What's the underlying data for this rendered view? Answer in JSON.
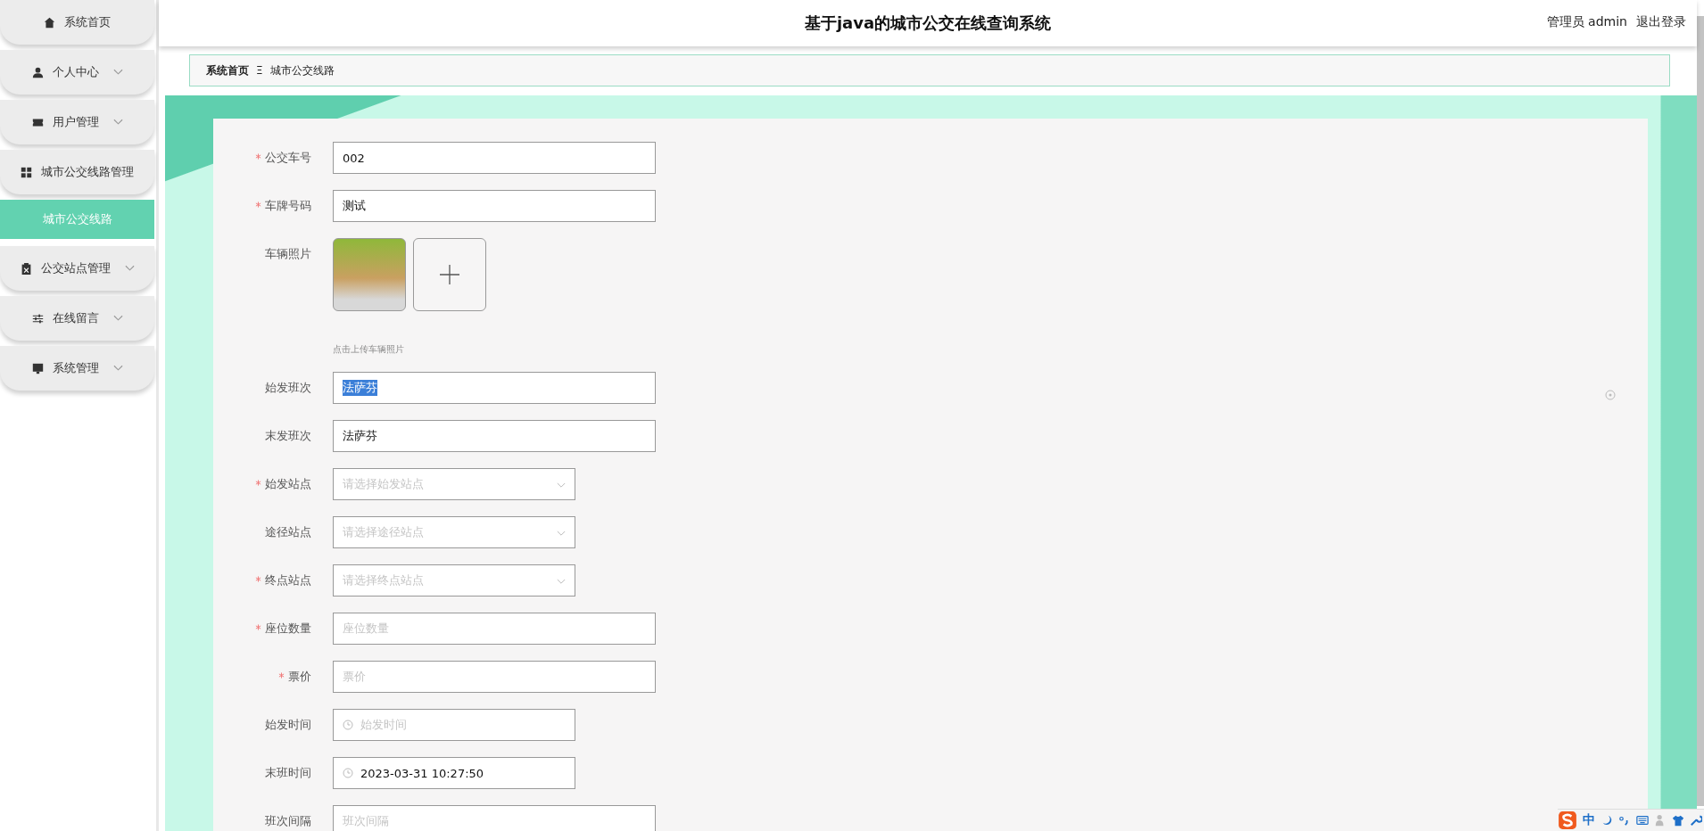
{
  "header": {
    "title": "基于java的城市公交在线查询系统",
    "user": "管理员 admin",
    "logout": "退出登录"
  },
  "sidebar": {
    "items": [
      {
        "label": "系统首页",
        "expandable": false,
        "selected": false
      },
      {
        "label": "个人中心",
        "expandable": true,
        "selected": false
      },
      {
        "label": "用户管理",
        "expandable": true,
        "selected": false
      },
      {
        "label": "城市公交线路管理",
        "expandable": false,
        "selected": false
      },
      {
        "label": "城市公交线路",
        "expandable": false,
        "selected": true
      },
      {
        "label": "公交站点管理",
        "expandable": true,
        "selected": false
      },
      {
        "label": "在线留言",
        "expandable": true,
        "selected": false
      },
      {
        "label": "系统管理",
        "expandable": true,
        "selected": false
      }
    ]
  },
  "breadcrumb": {
    "home": "系统首页",
    "separator": "Ξ",
    "current": "城市公交线路"
  },
  "form": {
    "fields": [
      {
        "kind": "text",
        "label": "公交车号",
        "required": true,
        "value": "002"
      },
      {
        "kind": "text",
        "label": "车牌号码",
        "required": true,
        "value": "测试"
      },
      {
        "kind": "upload",
        "label": "车辆照片",
        "required": false,
        "hint": "点击上传车辆照片"
      },
      {
        "kind": "text",
        "label": "始发班次",
        "required": false,
        "value": "法萨芬",
        "highlighted": true
      },
      {
        "kind": "text",
        "label": "末发班次",
        "required": false,
        "value": "法萨芬"
      },
      {
        "kind": "select",
        "label": "始发站点",
        "required": true,
        "placeholder": "请选择始发站点"
      },
      {
        "kind": "select",
        "label": "途径站点",
        "required": false,
        "placeholder": "请选择途径站点"
      },
      {
        "kind": "select",
        "label": "终点站点",
        "required": true,
        "placeholder": "请选择终点站点"
      },
      {
        "kind": "text",
        "label": "座位数量",
        "required": true,
        "placeholder": "座位数量"
      },
      {
        "kind": "text",
        "label": "票价",
        "required": true,
        "placeholder": "票价"
      },
      {
        "kind": "date",
        "label": "始发时间",
        "required": false,
        "placeholder": "始发时间"
      },
      {
        "kind": "date",
        "label": "末班时间",
        "required": false,
        "value": "2023-03-31 10:27:50"
      },
      {
        "kind": "text",
        "label": "班次间隔",
        "required": false,
        "placeholder": "班次间隔"
      }
    ]
  },
  "ime_toolbar": {
    "mode": "中"
  }
}
